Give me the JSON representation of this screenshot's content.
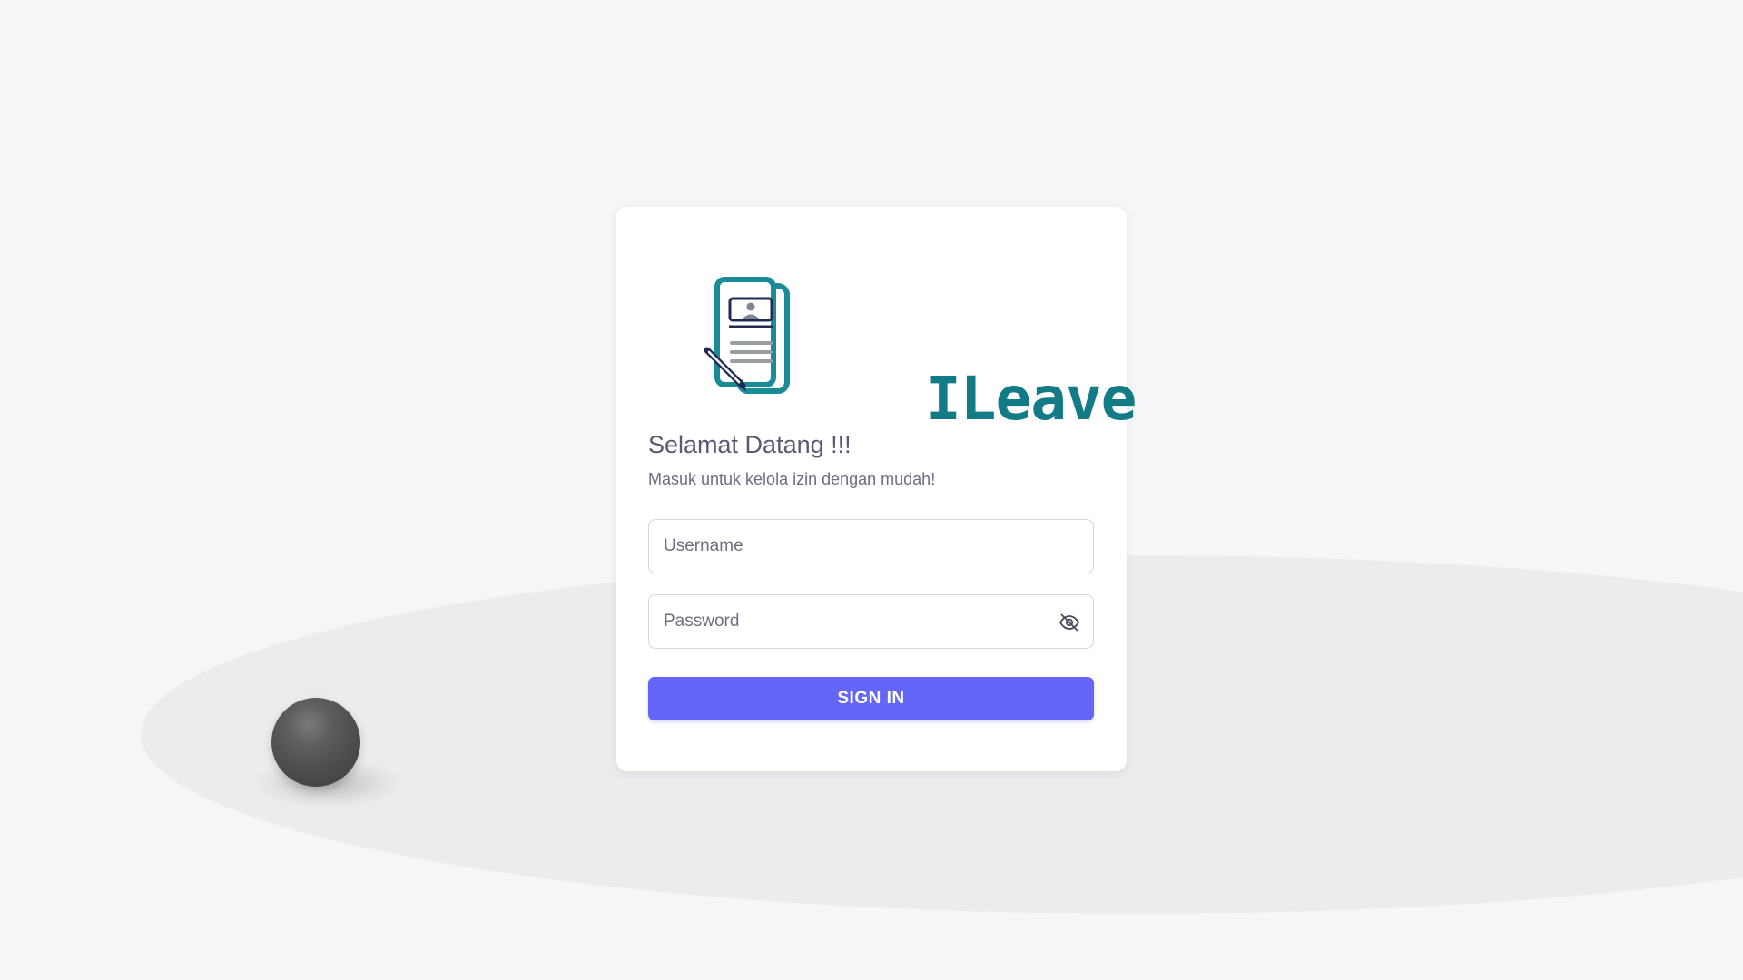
{
  "brand": {
    "name": "ILeave",
    "color": "#137b86"
  },
  "login": {
    "title": "Selamat Datang !!!",
    "subtitle": "Masuk untuk kelola izin dengan mudah!",
    "username_placeholder": "Username",
    "username_value": "",
    "password_placeholder": "Password",
    "password_value": "",
    "password_toggle_icon": "eye-off-icon",
    "signin_label": "SIGN IN",
    "signin_color": "#6366f8"
  }
}
